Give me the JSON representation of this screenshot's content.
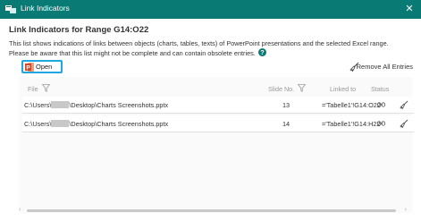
{
  "window": {
    "title": "Link Indicators",
    "close_glyph": "✕"
  },
  "heading": "Link Indicators for Range G14:O22",
  "description": {
    "line1": "This list shows indications of links between objects (charts, tables, texts) of PowerPoint presentations and the selected Excel range.",
    "line2": "Please be aware that this list might not be complete and can contain obsolete entries."
  },
  "toolbar": {
    "open_label": "Open",
    "remove_all_label": "Remove All Entries"
  },
  "columns": {
    "file": "File",
    "slide_no": "Slide No.",
    "linked_to": "Linked to",
    "status": "Status"
  },
  "rows": [
    {
      "path_prefix": "C:\\Users\\",
      "path_suffix": "\\Desktop\\Charts Screenshots.pptx",
      "slide": "13",
      "linked": "='Tabelle1'!G14:O22"
    },
    {
      "path_prefix": "C:\\Users\\",
      "path_suffix": "\\Desktop\\Charts Screenshots.pptx",
      "slide": "14",
      "linked": "='Tabelle1'!G14:H22"
    }
  ],
  "scroll": {
    "left_glyph": "‹",
    "right_glyph": "›"
  },
  "colors": {
    "titlebar": "#0a7a74",
    "accent": "#1ea8df",
    "ppt": "#d24726"
  },
  "icons": [
    "app-icon",
    "close-icon",
    "help-icon",
    "powerpoint-icon",
    "broom-icon",
    "filter-icon",
    "link-icon"
  ]
}
